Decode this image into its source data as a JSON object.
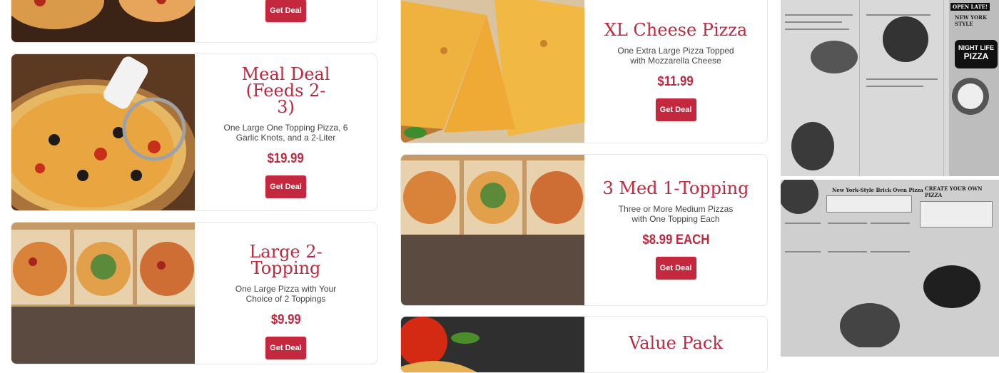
{
  "deals": [
    {
      "id": "top-left",
      "title": "",
      "description": "",
      "price": "",
      "button": "Get Deal"
    },
    {
      "id": "meal-deal",
      "title": "Meal Deal (Feeds 2-3)",
      "description": "One Large One Topping Pizza, 6 Garlic Knots, and a 2-Liter",
      "price": "$19.99",
      "button": "Get Deal"
    },
    {
      "id": "large-2-topping",
      "title": "Large 2-Topping",
      "description": "One Large Pizza with Your Choice of 2 Toppings",
      "price": "$9.99",
      "button": "Get Deal"
    },
    {
      "id": "xl-cheese",
      "title": "XL Cheese Pizza",
      "description": "One Extra Large Pizza Topped with Mozzarella Cheese",
      "price": "$11.99",
      "button": "Get Deal"
    },
    {
      "id": "3-med",
      "title": "3 Med 1-Topping",
      "description": "Three or More Medium Pizzas with One Topping Each",
      "price": "$8.99 EACH",
      "button": "Get Deal"
    },
    {
      "id": "value-pack",
      "title": "Value Pack",
      "description": "",
      "price": "",
      "button": ""
    }
  ],
  "menu_images": {
    "top_banner": "OPEN LATE!",
    "top_city": "NEW YORK STYLE",
    "logo_top": "NIGHT LIFE",
    "logo_bottom": "PIZZA",
    "bottom_title": "New York-Style Brick Oven Pizza",
    "bottom_cyo": "CREATE YOUR OWN PIZZA"
  },
  "colors": {
    "accent": "#c0283e",
    "button": "#c4283f"
  }
}
